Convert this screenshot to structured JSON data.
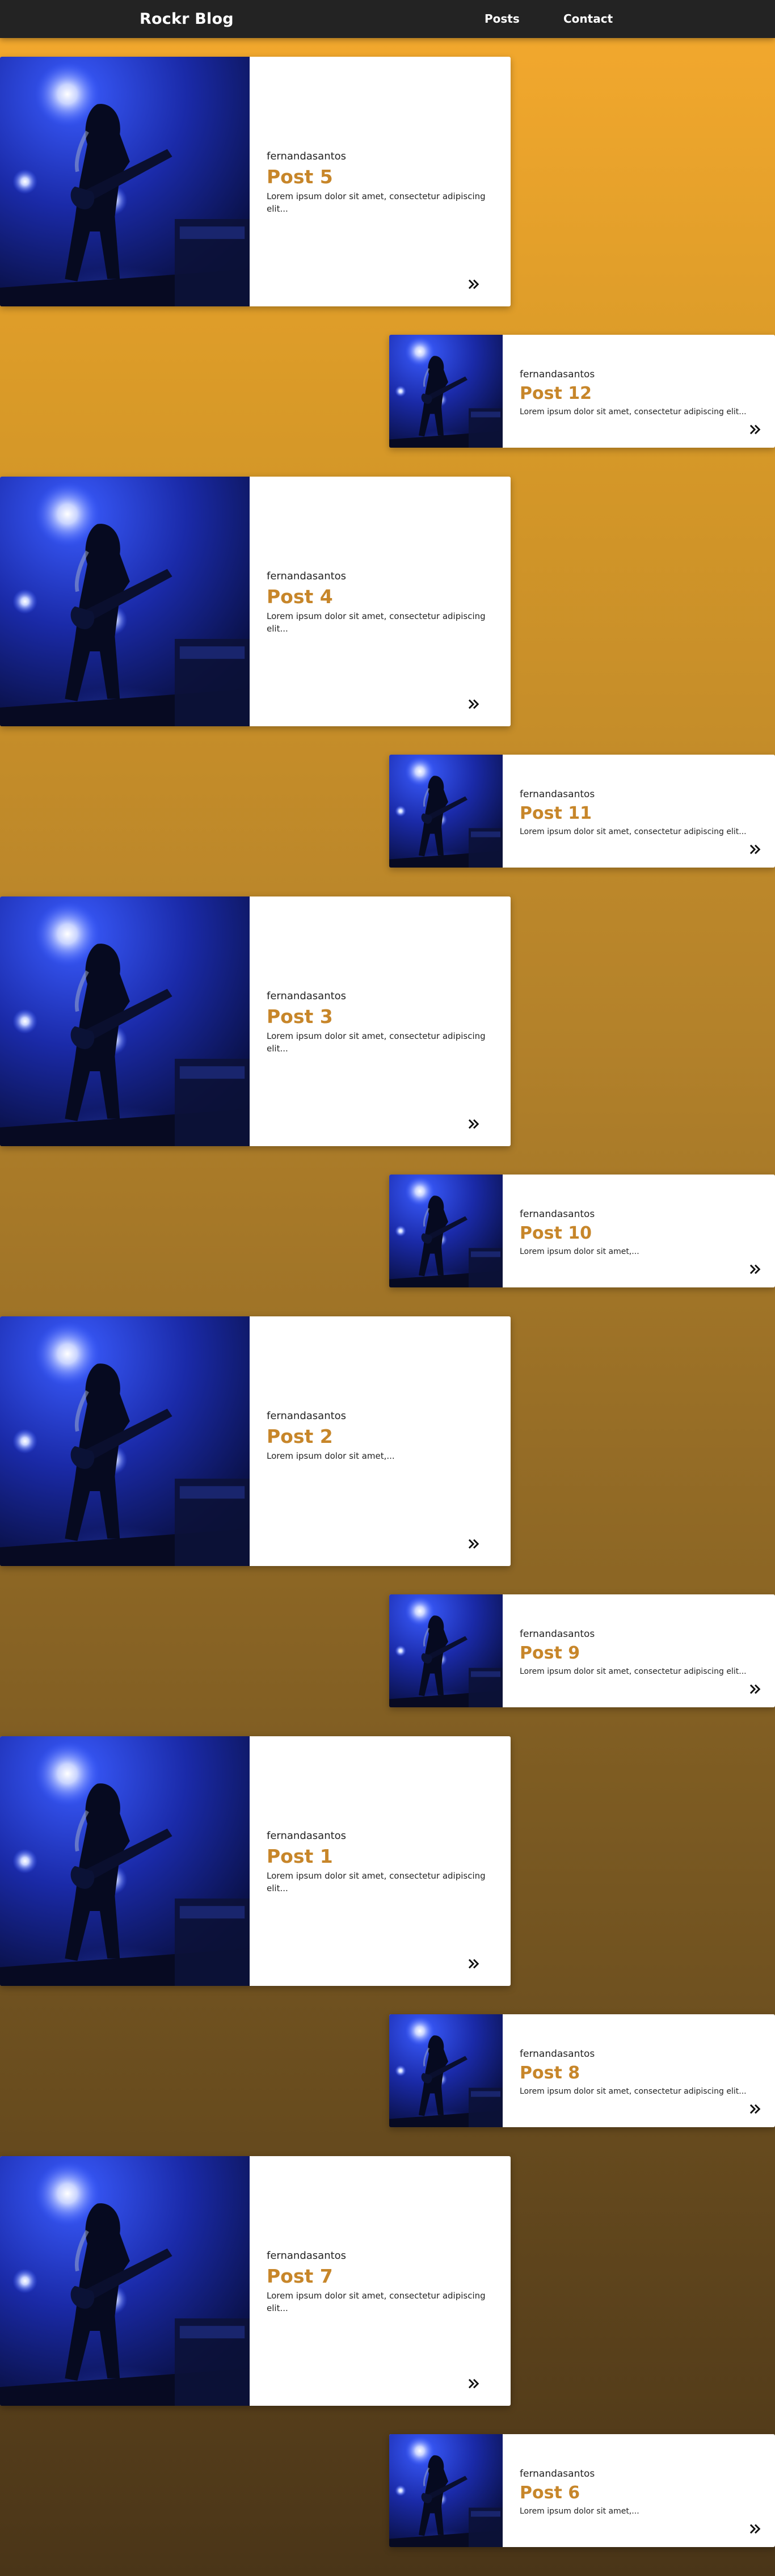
{
  "header": {
    "brand": "Rockr Blog",
    "nav": [
      {
        "label": "Posts"
      },
      {
        "label": "Contact"
      }
    ]
  },
  "posts": [
    {
      "author": "fernandasantos",
      "title": "Post 5",
      "excerpt": "Lorem ipsum dolor sit amet, consectetur adipiscing elit..."
    },
    {
      "author": "fernandasantos",
      "title": "Post 12",
      "excerpt": "Lorem ipsum dolor sit amet, consectetur adipiscing elit..."
    },
    {
      "author": "fernandasantos",
      "title": "Post 4",
      "excerpt": "Lorem ipsum dolor sit amet, consectetur adipiscing elit..."
    },
    {
      "author": "fernandasantos",
      "title": "Post 11",
      "excerpt": "Lorem ipsum dolor sit amet, consectetur adipiscing elit..."
    },
    {
      "author": "fernandasantos",
      "title": "Post 3",
      "excerpt": "Lorem ipsum dolor sit amet, consectetur adipiscing elit..."
    },
    {
      "author": "fernandasantos",
      "title": "Post 10",
      "excerpt": "Lorem ipsum dolor sit amet,..."
    },
    {
      "author": "fernandasantos",
      "title": "Post 2",
      "excerpt": "Lorem ipsum dolor sit amet,..."
    },
    {
      "author": "fernandasantos",
      "title": "Post 9",
      "excerpt": "Lorem ipsum dolor sit amet, consectetur adipiscing elit..."
    },
    {
      "author": "fernandasantos",
      "title": "Post 1",
      "excerpt": "Lorem ipsum dolor sit amet, consectetur adipiscing elit..."
    },
    {
      "author": "fernandasantos",
      "title": "Post 8",
      "excerpt": "Lorem ipsum dolor sit amet, consectetur adipiscing elit..."
    },
    {
      "author": "fernandasantos",
      "title": "Post 7",
      "excerpt": "Lorem ipsum dolor sit amet, consectetur adipiscing elit..."
    },
    {
      "author": "fernandasantos",
      "title": "Post 6",
      "excerpt": "Lorem ipsum dolor sit amet,..."
    }
  ],
  "icons": {
    "more": "double-chevron-right-icon",
    "thumbnail": "concert-guitarist-photo"
  },
  "colors": {
    "accent": "#c7862a",
    "header_bg": "#232323",
    "background_top": "#f4a92e",
    "background_bottom": "#4a3518"
  }
}
